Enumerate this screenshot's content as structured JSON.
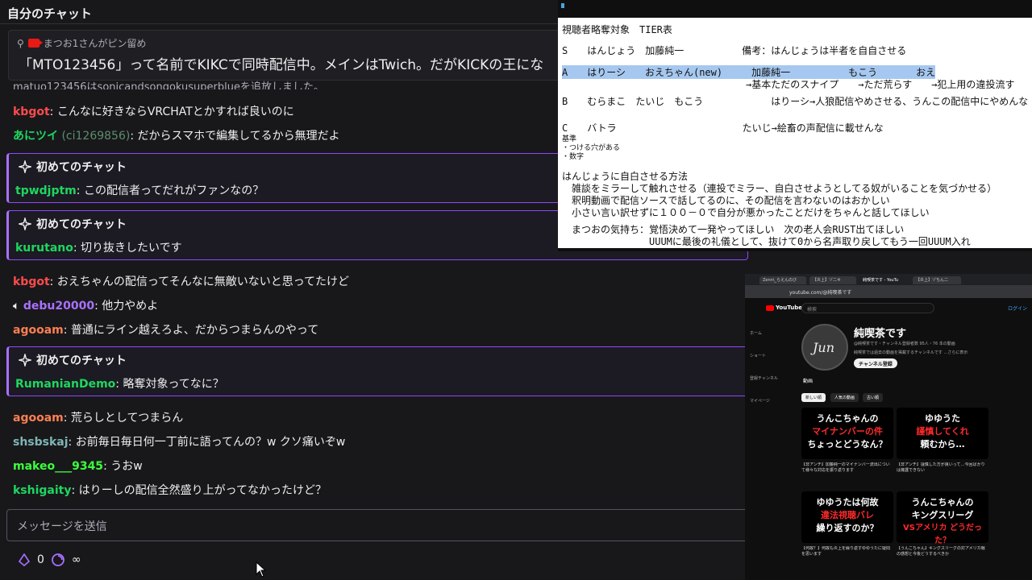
{
  "chat": {
    "header_title": "自分のチャット",
    "pinned": {
      "pinned_by": "まつお1さんがピン留め",
      "message": "「MTO123456」って名前でKIKCで同時配信中。メインはTwich。だがKICKの王にな"
    },
    "system_message": "matuo123456はsonicandsongokusuperblueを追放しました。",
    "messages": [
      {
        "user": "kbgot",
        "color": "#ff4b4b",
        "text": ": こんなに好きならVRCHATとかすれば良いのに"
      },
      {
        "user": "あにツイ",
        "user_sub": "(ci1269856)",
        "color": "#1ed760",
        "text": ": だからスマホで編集してるから無理だよ"
      },
      {
        "user": "kbgot",
        "color": "#ff4b4b",
        "text": ": おえちゃんの配信ってそんなに無敵いないと思ってたけど"
      },
      {
        "user": "debu20000",
        "color": "#a970ff",
        "text": ": 他力やめよ"
      },
      {
        "user": "agooam",
        "color": "#ff7f50",
        "text": ": 普通にライン越えろよ、だからつまらんのやって"
      },
      {
        "user": "agooam",
        "color": "#ff7f50",
        "text": ": 荒らしとしてつまらん"
      },
      {
        "user": "shsbskaj",
        "color": "#7fb5b5",
        "text": ": お前毎日毎日何一丁前に語ってんの？w クソ痛いぞw"
      },
      {
        "user": "makeo___9345",
        "color": "#3cff3c",
        "text": ": うおw"
      },
      {
        "user": "kshigaity",
        "color": "#1ed760",
        "text": ": はりーしの配信全然盛り上がってなかったけど？"
      }
    ],
    "first_chats": [
      {
        "label": "初めてのチャット",
        "user": "tpwdjptm",
        "color": "#1ed760",
        "text": ": この配信者ってだれがファンなの？"
      },
      {
        "label": "初めてのチャット",
        "user": "kurutano",
        "color": "#1ed760",
        "text": ": 切り抜きしたいです"
      },
      {
        "label": "初めてのチャット",
        "user": "RumanianDemo",
        "color": "#1ed760",
        "text": ": 略奪対象ってなに？"
      }
    ],
    "input_placeholder": "メッセージを送信",
    "points_value": "0",
    "infinity": "∞"
  },
  "tier": {
    "lines": [
      "視聴者略奪対象　TIER表",
      "S　　はんじょう　加藤純一　　　　　　備考：はんじょうは半者を自自させる",
      "A　　はりーシ　　おえちゃん(new)　　　加藤純一　　　　　　もこう　　　　おえ",
      "　　　　　　　　　　　　　　　　　　　→基本ただのスナイプ　　→ただ荒らす　　→犯上用の違投流す",
      "B　　むらまこ　たいじ　もこう　　　　　　　はりーシ→人狼配信やめさせる、うんこの配信中にやめんな",
      "C　　バトラ　　　　　　　　　　　　　たいじ→絵畜の声配信に載せんな",
      "基準",
      "・つける穴がある",
      "・数字",
      "はんじょうに自白させる方法",
      "　雑談をミラーして触れさせる（連投でミラー、自白させようとしてる奴がいることを気づかせる）",
      "　釈明動画で配信ソースで話してるのに、その配信を言わないのはおかしい",
      "　小さい言い訳せずに１００－０で自分が悪かったことだけをちゃんと話してほしい",
      "　まつおの気持ち：覚悟決めて一発やってほしい　次の老人会RUST出てほしい",
      "　　　　　　　　　UUUMに最後の礼儀として、抜けて0から名声取り戻してもう一回UUUM入れ"
    ]
  },
  "youtube": {
    "tabs": [
      "Zenn\\_らえんのび",
      "【炎上】ゾ二キ",
      "純喫茶です - YouTu",
      "【炎上】ゾちん二"
    ],
    "url": "youtube.com/@純喫茶です",
    "logo_text": "YouTube",
    "search_placeholder": "検索",
    "login_label": "ログイン",
    "side_items": [
      "ホーム",
      "ショート",
      "登録チャンネル",
      "マイページ"
    ],
    "channel_name": "純喫茶です",
    "avatar_text": "Jun",
    "channel_meta": "@純喫茶です・チャンネル登録者数 95人・76 本の動画",
    "channel_desc": "純喫茶では過去の動画を掲載するチャンネルです ...さらに表示",
    "subscribe_label": "チャンネル登録",
    "nav_tabs": [
      "動画"
    ],
    "chips": [
      "新しい順",
      "人気の動画",
      "古い順"
    ],
    "videos": [
      {
        "line1": "うんこちゃんの",
        "line2": "マイナンバーの件",
        "line3": "ちょっとどうなん？",
        "caption": "【非アンチ】加藤純一のマイナンバー流出について様々な対応を振り返ります"
      },
      {
        "line1": "ゆゆうた",
        "line2": "謹慎してくれ",
        "line3": "頼むから…",
        "caption": "【非アンチ】謹慎した方が良いって…今回ばかりは擁護できない"
      },
      {
        "line1": "ゆゆうたは何故",
        "line2": "違法視聴バレ",
        "line3": "繰り返すのか？",
        "caption": "【何故？】何故も炎上を繰り返すゆゆうたに疑問を思います"
      },
      {
        "line1": "うんこちゃんの",
        "line2": "キングスリーグ",
        "line3": "VSアメリカ どうだった？",
        "caption": "【うんこちゃん】キングスリーグの対アメリカ戦の感想と今後どうするべきか"
      }
    ]
  }
}
